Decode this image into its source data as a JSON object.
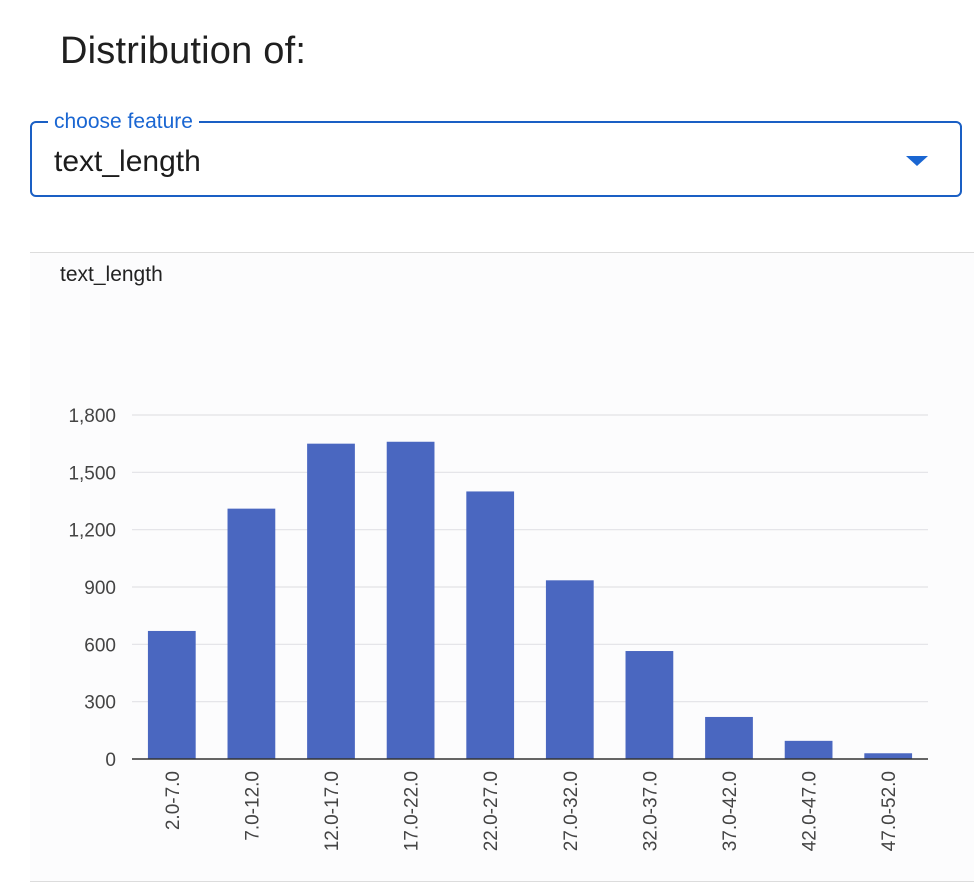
{
  "header": {
    "title": "Distribution of:"
  },
  "feature_select": {
    "legend": "choose feature",
    "value": "text_length"
  },
  "chart_data": {
    "type": "bar",
    "title": "text_length",
    "xlabel": "",
    "ylabel": "",
    "categories": [
      "2.0-7.0",
      "7.0-12.0",
      "12.0-17.0",
      "17.0-22.0",
      "22.0-27.0",
      "27.0-32.0",
      "32.0-37.0",
      "37.0-42.0",
      "42.0-47.0",
      "47.0-52.0"
    ],
    "values": [
      670,
      1310,
      1650,
      1660,
      1400,
      935,
      565,
      220,
      95,
      30
    ],
    "ylim": [
      0,
      1800
    ],
    "yticks": [
      0,
      300,
      600,
      900,
      1200,
      1500,
      1800
    ],
    "ytick_labels": [
      "0",
      "300",
      "600",
      "900",
      "1,200",
      "1,500",
      "1,800"
    ],
    "grid": true,
    "colors": {
      "bar": "#4a67c0",
      "grid": "#e2e2e6",
      "axis": "#333333"
    }
  }
}
